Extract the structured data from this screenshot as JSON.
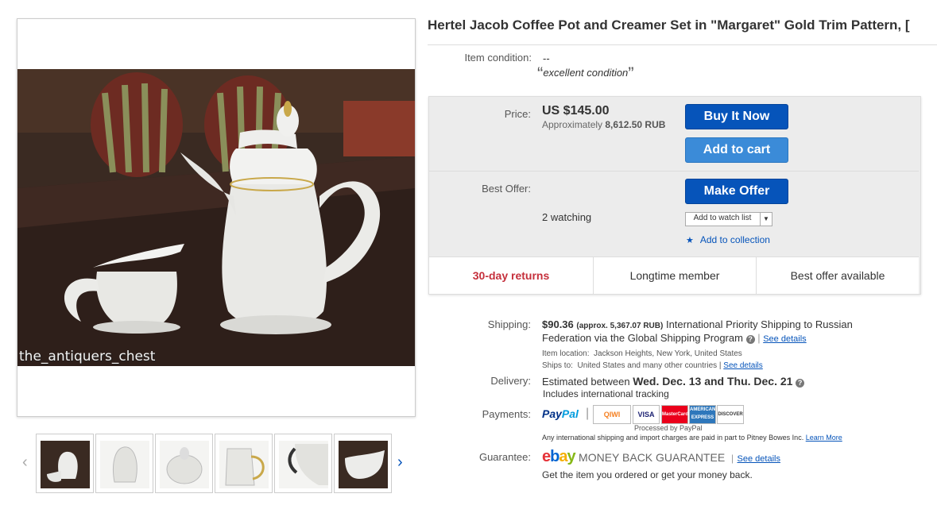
{
  "listing": {
    "title": "Hertel Jacob Coffee Pot and Creamer Set in \"Margaret\" Gold Trim Pattern, [",
    "watermark": "the_antiquers_chest"
  },
  "condition": {
    "label": "Item condition:",
    "value": "--",
    "note": "excellent condition",
    "open_quote": "“",
    "close_quote": "”"
  },
  "price": {
    "label": "Price:",
    "value": "US $145.00",
    "approx_prefix": "Approximately ",
    "approx_value": "8,612.50 RUB",
    "buy_now": "Buy It Now",
    "add_to_cart": "Add to cart"
  },
  "offer": {
    "label": "Best Offer:",
    "make_offer": "Make Offer",
    "watching": "2 watching",
    "add_to_watch": "Add to watch list",
    "add_to_collection": "Add to collection"
  },
  "features": [
    "30-day returns",
    "Longtime member",
    "Best offer available"
  ],
  "shipping": {
    "label": "Shipping:",
    "amount": "$90.36",
    "approx": "(approx. 5,367.07 RUB)",
    "service": "International Priority Shipping to Russian Federation",
    "via": "via the Global Shipping Program",
    "help": "?",
    "see_details": "See details",
    "location_label": "Item location:",
    "location": "Jackson Heights, New York, United States",
    "ships_to_label": "Ships to:",
    "ships_to": "United States and many other countries",
    "see_details_2": "See details"
  },
  "delivery": {
    "label": "Delivery:",
    "prefix": "Estimated between ",
    "range": "Wed. Dec. 13 and Thu. Dec. 21",
    "help": "?",
    "tracking": "Includes international tracking"
  },
  "payments": {
    "label": "Payments:",
    "paypal_1": "Pay",
    "paypal_2": "Pal",
    "qiwi": "QIWI",
    "visa": "VISA",
    "mastercard": "MasterCard",
    "amex": "AMERICAN EXPRESS",
    "discover": "DISCOVER",
    "processed_by": "Processed by PayPal",
    "note": "Any international shipping and import charges are paid in part to Pitney Bowes Inc.",
    "learn_more": "Learn More"
  },
  "guarantee": {
    "label": "Guarantee:",
    "logo": "ebay",
    "text": "MONEY BACK GUARANTEE",
    "see_details": "See details",
    "sub": "Get the item you ordered or get your money back."
  },
  "colors": {
    "accent_blue": "#0654ba",
    "returns_red": "#c5303c",
    "ebay_e": "#e53238",
    "ebay_b": "#0064d2",
    "ebay_a": "#f5af02",
    "ebay_y": "#86b817"
  },
  "icons": {
    "prev": "chevron-left-icon",
    "next": "chevron-right-icon",
    "star": "star-icon"
  },
  "gallery": {
    "thumb_count": 6,
    "prev_glyph": "‹",
    "next_glyph": "›",
    "star_glyph": "★"
  }
}
